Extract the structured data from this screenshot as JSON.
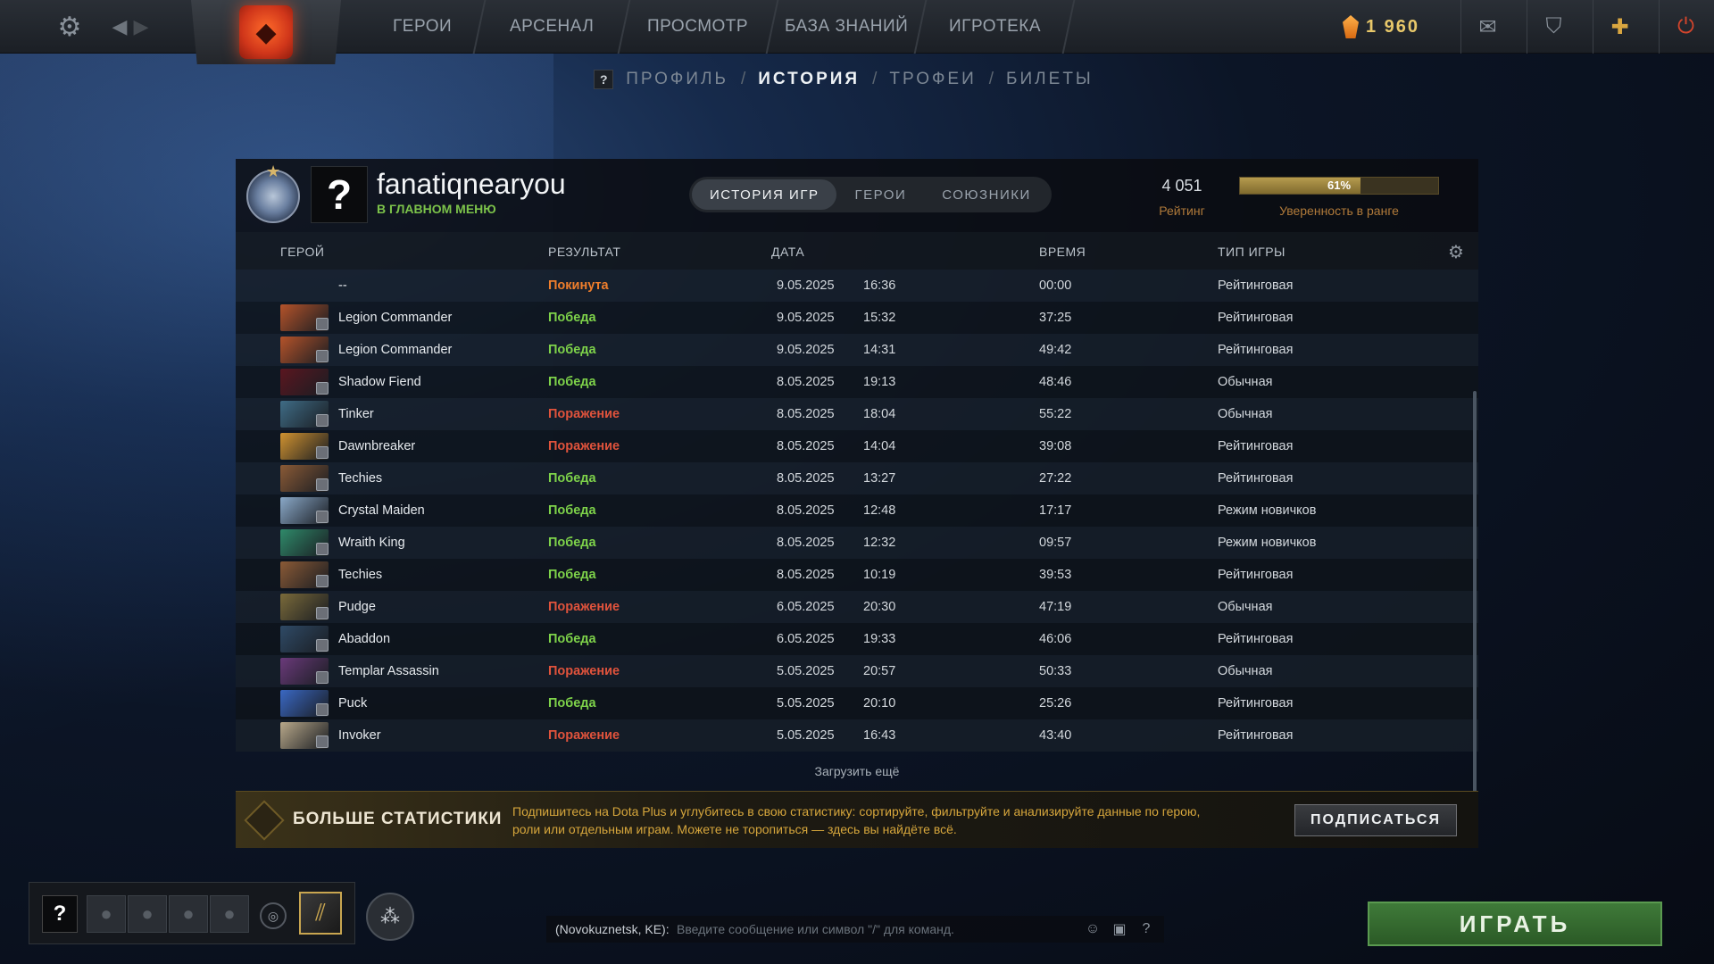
{
  "topnav": {
    "items": [
      "ГЕРОИ",
      "АРСЕНАЛ",
      "ПРОСМОТР",
      "БАЗА ЗНАНИЙ",
      "ИГРОТЕКА"
    ],
    "currency": "1 960"
  },
  "subnav": {
    "q": "?",
    "tabs": [
      "ПРОФИЛЬ",
      "ИСТОРИЯ",
      "ТРОФЕИ",
      "БИЛЕТЫ"
    ],
    "active": "ИСТОРИЯ"
  },
  "profile": {
    "avatar": "?",
    "username": "fanatiqnearyou",
    "status": "В ГЛАВНОМ МЕНЮ",
    "tabs": [
      "ИСТОРИЯ ИГР",
      "ГЕРОИ",
      "СОЮЗНИКИ"
    ],
    "rating": "4 051",
    "rating_label": "Рейтинг",
    "confidence": 0.61,
    "confidence_text": "61%",
    "confidence_label": "Уверенность в ранге"
  },
  "table": {
    "headers": [
      "ГЕРОЙ",
      "РЕЗУЛЬТАТ",
      "ДАТА",
      "ВРЕМЯ",
      "ТИП ИГРЫ"
    ],
    "rows": [
      {
        "hero": "--",
        "result": "Покинута",
        "status": "abandon",
        "date": "9.05.2025",
        "time": "16:36",
        "duration": "00:00",
        "type": "Рейтинговая",
        "color": ""
      },
      {
        "hero": "Legion Commander",
        "result": "Победа",
        "status": "win",
        "date": "9.05.2025",
        "time": "15:32",
        "duration": "37:25",
        "type": "Рейтинговая",
        "color": "#b5532a"
      },
      {
        "hero": "Legion Commander",
        "result": "Победа",
        "status": "win",
        "date": "9.05.2025",
        "time": "14:31",
        "duration": "49:42",
        "type": "Рейтинговая",
        "color": "#b5532a"
      },
      {
        "hero": "Shadow Fiend",
        "result": "Победа",
        "status": "win",
        "date": "8.05.2025",
        "time": "19:13",
        "duration": "48:46",
        "type": "Обычная",
        "color": "#5a1620"
      },
      {
        "hero": "Tinker",
        "result": "Поражение",
        "status": "loss",
        "date": "8.05.2025",
        "time": "18:04",
        "duration": "55:22",
        "type": "Обычная",
        "color": "#3f6c86"
      },
      {
        "hero": "Dawnbreaker",
        "result": "Поражение",
        "status": "loss",
        "date": "8.05.2025",
        "time": "14:04",
        "duration": "39:08",
        "type": "Рейтинговая",
        "color": "#d09230"
      },
      {
        "hero": "Techies",
        "result": "Победа",
        "status": "win",
        "date": "8.05.2025",
        "time": "13:27",
        "duration": "27:22",
        "type": "Рейтинговая",
        "color": "#8a5a36"
      },
      {
        "hero": "Crystal Maiden",
        "result": "Победа",
        "status": "win",
        "date": "8.05.2025",
        "time": "12:48",
        "duration": "17:17",
        "type": "Режим новичков",
        "color": "#8aa9c9"
      },
      {
        "hero": "Wraith King",
        "result": "Победа",
        "status": "win",
        "date": "8.05.2025",
        "time": "12:32",
        "duration": "09:57",
        "type": "Режим новичков",
        "color": "#2f8a6a"
      },
      {
        "hero": "Techies",
        "result": "Победа",
        "status": "win",
        "date": "8.05.2025",
        "time": "10:19",
        "duration": "39:53",
        "type": "Рейтинговая",
        "color": "#8a5a36"
      },
      {
        "hero": "Pudge",
        "result": "Поражение",
        "status": "loss",
        "date": "6.05.2025",
        "time": "20:30",
        "duration": "47:19",
        "type": "Обычная",
        "color": "#7a6a3a"
      },
      {
        "hero": "Abaddon",
        "result": "Победа",
        "status": "win",
        "date": "6.05.2025",
        "time": "19:33",
        "duration": "46:06",
        "type": "Рейтинговая",
        "color": "#2f4a66"
      },
      {
        "hero": "Templar Assassin",
        "result": "Поражение",
        "status": "loss",
        "date": "5.05.2025",
        "time": "20:57",
        "duration": "50:33",
        "type": "Обычная",
        "color": "#6a3a7a"
      },
      {
        "hero": "Puck",
        "result": "Победа",
        "status": "win",
        "date": "5.05.2025",
        "time": "20:10",
        "duration": "25:26",
        "type": "Рейтинговая",
        "color": "#3a68c4"
      },
      {
        "hero": "Invoker",
        "result": "Поражение",
        "status": "loss",
        "date": "5.05.2025",
        "time": "16:43",
        "duration": "43:40",
        "type": "Рейтинговая",
        "color": "#b8a88a"
      }
    ],
    "load_more": "Загрузить ещё"
  },
  "promo": {
    "title": "БОЛЬШЕ СТАТИСТИКИ",
    "text": "Подпишитесь на Dota Plus и углубитесь в свою статистику: сортируйте, фильтруйте и анализируйте данные по герою, роли или отдельным играм. Можете не торопиться — здесь вы найдёте всё.",
    "button": "ПОДПИСАТЬСЯ"
  },
  "bottom": {
    "party_q": "?",
    "chat_channel": "(Novokuznetsk, KE):",
    "chat_placeholder": "Введите сообщение или символ \"/\" для команд.",
    "help": "?",
    "play": "ИГРАТЬ"
  },
  "colors": {
    "win": "#7ed34a",
    "loss": "#e0533c",
    "abandon": "#ef7e2c",
    "accent_gold": "#d9a640"
  }
}
